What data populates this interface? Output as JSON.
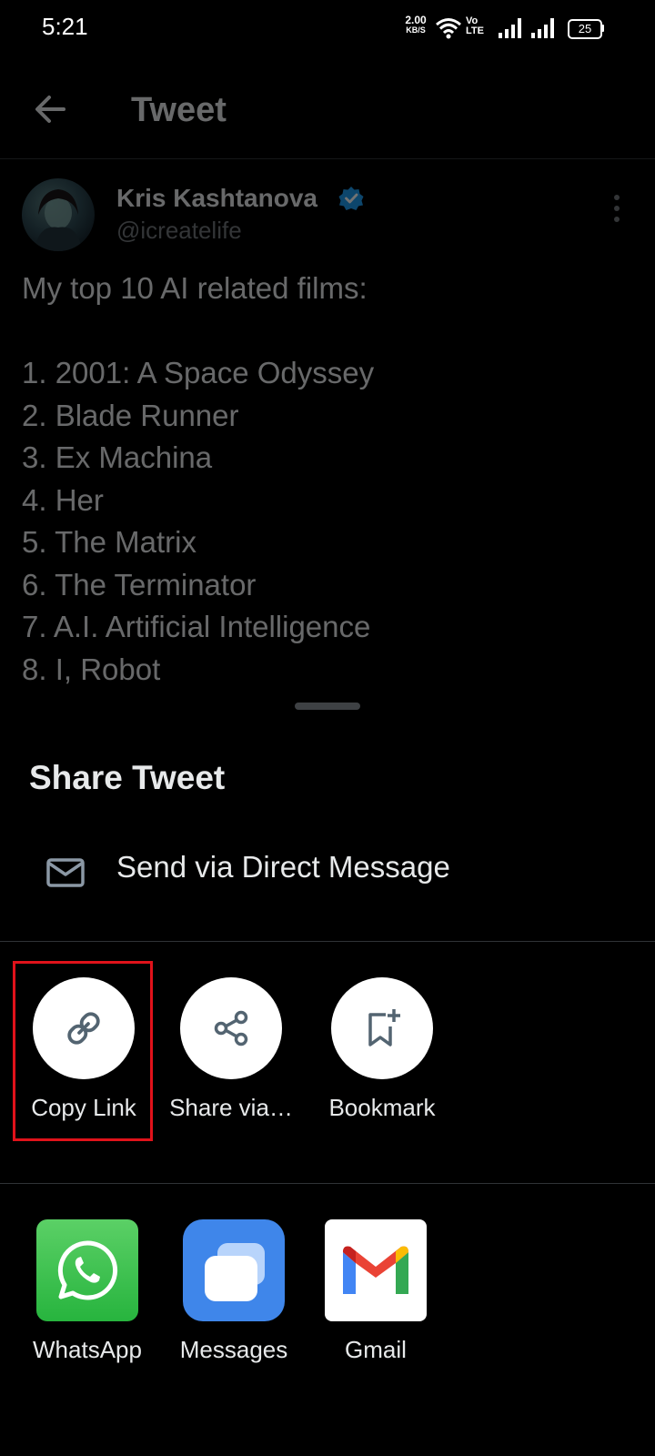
{
  "status_bar": {
    "time": "5:21",
    "net_speed_value": "2.00",
    "net_speed_unit": "KB/S",
    "volte_top": "Vo",
    "volte_bottom": "LTE",
    "battery": "25"
  },
  "header": {
    "title": "Tweet"
  },
  "tweet": {
    "display_name": "Kris Kashtanova",
    "handle": "@icreatelife",
    "verified": true,
    "text": "My top 10 AI related films:\n\n1. 2001: A Space Odyssey\n2. Blade Runner\n3. Ex Machina\n4. Her\n5. The Matrix\n6. The Terminator\n7. A.I. Artificial Intelligence\n8. I, Robot"
  },
  "share_sheet": {
    "title": "Share Tweet",
    "direct_message_label": "Send via Direct Message",
    "actions": [
      {
        "label": "Copy Link",
        "icon": "link-icon",
        "highlighted": true
      },
      {
        "label": "Share via…",
        "icon": "share-icon",
        "highlighted": false
      },
      {
        "label": "Bookmark",
        "icon": "bookmark-add-icon",
        "highlighted": false
      }
    ],
    "apps": [
      {
        "label": "WhatsApp",
        "icon": "whatsapp-icon",
        "color": "#25D366"
      },
      {
        "label": "Messages",
        "icon": "messages-icon",
        "color": "#3f86ea"
      },
      {
        "label": "Gmail",
        "icon": "gmail-icon",
        "color": "#ffffff"
      }
    ]
  },
  "colors": {
    "background": "#000000",
    "highlight": "#e0121a",
    "verified": "#1d9bf0"
  }
}
